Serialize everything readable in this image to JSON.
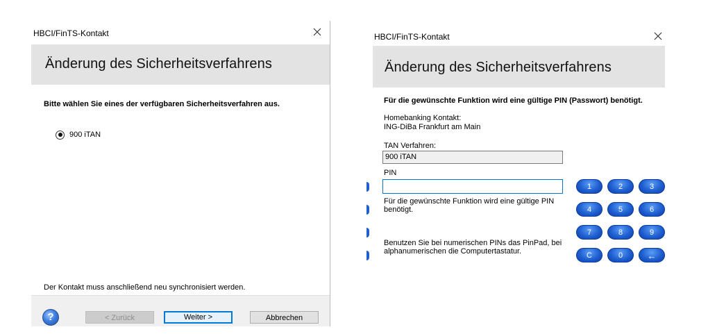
{
  "left_dialog": {
    "title": "HBCI/FinTS-Kontakt",
    "banner_title": "Änderung des Sicherheitsverfahrens",
    "instruction": "Bitte wählen Sie eines der verfügbaren Sicherheitsverfahren aus.",
    "option_label": "900 iTAN",
    "option_selected": true,
    "note": "Der Kontakt muss anschließend neu synchronisiert werden.",
    "buttons": {
      "help": "?",
      "back": "< Zurück",
      "next": "Weiter >",
      "cancel": "Abbrechen"
    }
  },
  "right_dialog": {
    "title": "HBCI/FinTS-Kontakt",
    "banner_title": "Änderung des Sicherheitsverfahrens",
    "instruction": "Für die gewünschte Funktion wird eine gültige PIN (Passwort) benötigt.",
    "contact_label": "Homebanking Kontakt:",
    "contact_value": "ING-DiBa Frankfurt am Main",
    "tan_label": "TAN Verfahren:",
    "tan_value": "900 iTAN",
    "pin_label": "PIN",
    "pin_value": "",
    "hint_line1": "Für die gewünschte Funktion wird eine gültige PIN",
    "hint_line2": "benötigt.",
    "pinpad_hint_line1": "Benutzen Sie bei numerischen PINs das PinPad, bei",
    "pinpad_hint_line2": "alphanumerischen die Computertastatur.",
    "pinpad": [
      "1",
      "2",
      "3",
      "4",
      "5",
      "6",
      "7",
      "8",
      "9",
      "C",
      "0",
      "←"
    ]
  },
  "colors": {
    "banner_bg": "#e3e3e3",
    "footer_bg": "#f0f0f0",
    "focus_blue": "#0078d7",
    "pinpad_blue": "#1f5fd0"
  }
}
